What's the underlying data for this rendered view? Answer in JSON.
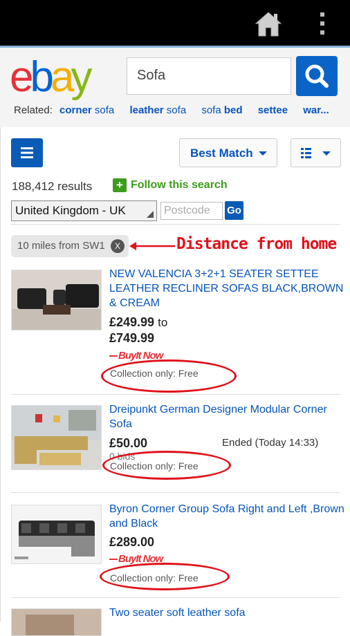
{
  "topbar": {
    "home_icon": "home-icon",
    "menu_icon": "overflow-menu-icon"
  },
  "header": {
    "logo": "ebay",
    "search": {
      "value": "Sofa",
      "button_icon": "search-icon"
    },
    "related": {
      "label": "Related:",
      "items": [
        {
          "pre": "corner",
          "bold": "",
          "post": " sofa"
        },
        {
          "pre": "leather",
          "bold": "",
          "post": " sofa"
        },
        {
          "pre": "sofa ",
          "bold": "bed",
          "post": ""
        },
        {
          "pre": "settee",
          "bold": "",
          "post": ""
        },
        {
          "pre": "war...",
          "bold": "",
          "post": ""
        }
      ]
    }
  },
  "toolbar": {
    "sort_label": "Best Match",
    "list_icon": "list-menu-icon",
    "view_icon": "view-options-icon"
  },
  "results": {
    "count": "188,412 results",
    "follow_label": "Follow this search"
  },
  "location": {
    "country": "United Kingdom - UK",
    "postcode_placeholder": "Postcode",
    "go_label": "Go"
  },
  "filter_chip": {
    "label": "10 miles from SW1",
    "remove": "X"
  },
  "annotation": {
    "text": "Distance from home",
    "color": "#e0121b"
  },
  "items": [
    {
      "title": "NEW VALENCIA 3+2+1 SEATER SETTEE LEATHER RECLINER SOFAS BLACK,BROWN & CREAM",
      "price": "£249.99",
      "price_to": "to",
      "price_max": "£749.99",
      "badge": "BuyIt Now",
      "collection": "Collection only: Free"
    },
    {
      "title": "Dreipunkt German Designer Modular Corner Sofa",
      "price": "£50.00",
      "bids": "0 bids",
      "ended": "Ended (Today 14:33)",
      "collection": "Collection only: Free"
    },
    {
      "title": "Byron Corner Group Sofa Right and Left ,Brown and Black",
      "price": "£289.00",
      "badge": "BuyIt Now",
      "collection": "Collection only: Free"
    },
    {
      "title": "Two seater soft leather sofa"
    }
  ],
  "colors": {
    "ebay_red": "#e53238",
    "ebay_blue": "#0064d2",
    "ebay_yellow": "#f5af02",
    "ebay_green": "#86b817",
    "link": "#0654ba",
    "follow_green": "#3c9c1c"
  }
}
